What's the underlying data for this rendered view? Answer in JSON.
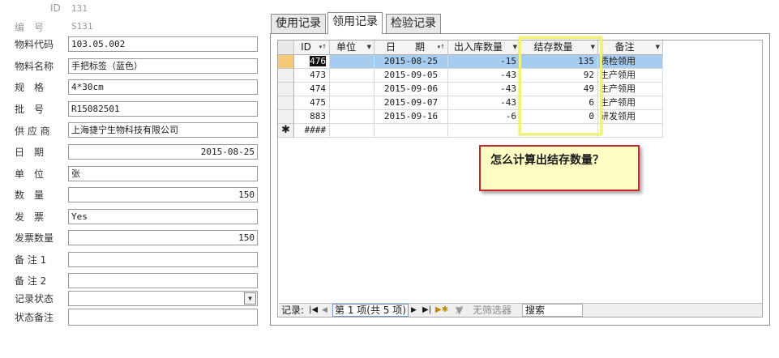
{
  "form": {
    "id_label": "ID",
    "id_value": "131",
    "code_label": "编　号",
    "code_value": "S131",
    "fields": [
      {
        "label": "物料代码",
        "value": "103.05.002"
      },
      {
        "label": "物料名称",
        "value": "手把标签（蓝色）"
      },
      {
        "label": "规　格",
        "value": "4*30cm"
      },
      {
        "label": "批　号",
        "value": "R15082501"
      },
      {
        "label": "供 应 商",
        "value": "上海捷宁生物科技有限公司"
      },
      {
        "label": "日　期",
        "value": "2015-08-25"
      },
      {
        "label": "单　位",
        "value": "张"
      },
      {
        "label": "数　量",
        "value": "150"
      },
      {
        "label": "发　票",
        "value": "Yes"
      },
      {
        "label": "发票数量",
        "value": "150"
      },
      {
        "label": "备 注 1",
        "value": ""
      },
      {
        "label": "备 注 2",
        "value": ""
      },
      {
        "label": "记录状态",
        "value": ""
      },
      {
        "label": "状态备注",
        "value": ""
      }
    ]
  },
  "tabs": [
    "使用记录",
    "领用记录",
    "检验记录"
  ],
  "active_tab": "领用记录",
  "grid": {
    "headers": [
      "ID",
      "单位",
      "日　　期",
      "出入库数量",
      "结存数量",
      "备注"
    ],
    "rows": [
      {
        "id": "476",
        "unit": "",
        "date": "2015-08-25",
        "qty": "-15",
        "balance": "135",
        "note": "质检领用"
      },
      {
        "id": "473",
        "unit": "",
        "date": "2015-09-05",
        "qty": "-43",
        "balance": "92",
        "note": "生产领用"
      },
      {
        "id": "474",
        "unit": "",
        "date": "2015-09-06",
        "qty": "-43",
        "balance": "49",
        "note": "生产领用"
      },
      {
        "id": "475",
        "unit": "",
        "date": "2015-09-07",
        "qty": "-43",
        "balance": "6",
        "note": "生产领用"
      },
      {
        "id": "883",
        "unit": "",
        "date": "2015-09-16",
        "qty": "-6",
        "balance": "0",
        "note": "研发领用"
      }
    ],
    "new_row_id": "####",
    "new_row_marker": "✱"
  },
  "nav": {
    "label": "记录:",
    "position": "第 1 项(共 5 项)",
    "filter": "无筛选器",
    "search": "搜索"
  },
  "callout": "怎么计算出结存数量？",
  "colors": {
    "selected_row": "#a6cdf0",
    "callout_bg": "#ffffc4",
    "callout_border": "#c8262c",
    "highlight": "#f2f27a"
  }
}
